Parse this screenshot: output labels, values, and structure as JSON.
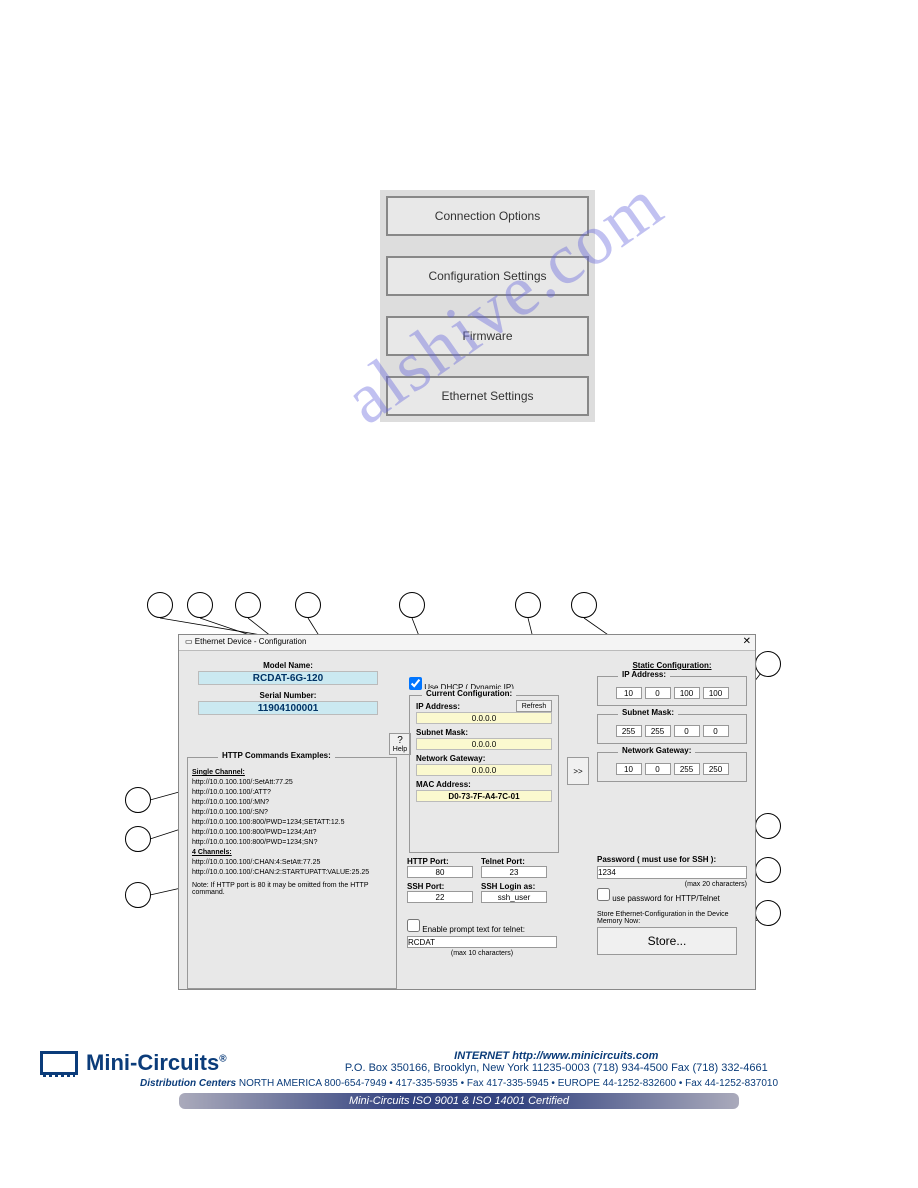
{
  "top_buttons": {
    "connection": "Connection Options",
    "config": "Configuration Settings",
    "firmware": "Firmware",
    "ethernet": "Ethernet Settings"
  },
  "watermark": "alshive.com",
  "dialog": {
    "title": "Ethernet Device - Configuration",
    "model_name_label": "Model Name:",
    "model_name": "RCDAT-6G-120",
    "serial_label": "Serial Number:",
    "serial": "11904100001",
    "help": "Help",
    "http_group_title": "HTTP Commands Examples:",
    "http_lines": {
      "sc": "Single Channel:",
      "l1": "http://10.0.100.100/:SetAtt:77.25",
      "l2": "http://10.0.100.100/:ATT?",
      "l3": "http://10.0.100.100/:MN?",
      "l4": "http://10.0.100.100/:SN?",
      "l5": "http://10.0.100.100:800/PWD=1234;SETATT:12.5",
      "l6": "http://10.0.100.100:800/PWD=1234;Att?",
      "l7": "http://10.0.100.100:800/PWD=1234;SN?",
      "fc": "4 Channels:",
      "l8": "http://10.0.100.100/:CHAN:4:SetAtt:77.25",
      "l9": "http://10.0.100.100/:CHAN:2:STARTUPATT:VALUE:25.25",
      "note": "Note:  If HTTP port is 80 it may be omitted from the HTTP command."
    },
    "use_dhcp": "Use DHCP ( Dynamic IP)",
    "current_title": "Current Configuration:",
    "refresh": "Refresh",
    "ip_label": "IP Address:",
    "ip_val": "0.0.0.0",
    "subnet_label": "Subnet Mask:",
    "subnet_val": "0.0.0.0",
    "gateway_label": "Network Gateway:",
    "gateway_val": "0.0.0.0",
    "mac_label": "MAC Address:",
    "mac_val": "D0-73-7F-A4-7C-01",
    "copy_btn": ">>",
    "static_title": "Static Configuration:",
    "static_ip_title": "IP Address:",
    "static_ip": [
      "10",
      "0",
      "100",
      "100"
    ],
    "static_subnet_title": "Subnet Mask:",
    "static_subnet": [
      "255",
      "255",
      "0",
      "0"
    ],
    "static_gw_title": "Network Gateway:",
    "static_gw": [
      "10",
      "0",
      "255",
      "250"
    ],
    "http_port_label": "HTTP Port:",
    "http_port": "80",
    "telnet_port_label": "Telnet Port:",
    "telnet_port": "23",
    "ssh_port_label": "SSH Port:",
    "ssh_port": "22",
    "ssh_login_label": "SSH Login as:",
    "ssh_login": "ssh_user",
    "prompt_label": "Enable prompt text for telnet:",
    "prompt_val": "RCDAT",
    "prompt_hint": "(max 10 characters)",
    "pw_label": "Password ( must use for SSH ):",
    "pw_val": "1234",
    "pw_hint": "(max 20 characters)",
    "pw_chk": "use password for HTTP/Telnet",
    "store_label": "Store Ethernet-Configuration in the Device Memory Now:",
    "store_btn": "Store..."
  },
  "footer": {
    "brand": "Mini-Circuits",
    "internet": "INTERNET  http://www.minicircuits.com",
    "addr": "P.O. Box 350166, Brooklyn, New York 11235-0003 (718) 934-4500  Fax (718) 332-4661",
    "dist_label": "Distribution Centers",
    "dist": " NORTH AMERICA  800-654-7949  •  417-335-5935  •  Fax 417-335-5945 • EUROPE 44-1252-832600 • Fax 44-1252-837010",
    "band": "Mini-Circuits ISO 9001 & ISO 14001 Certified"
  }
}
